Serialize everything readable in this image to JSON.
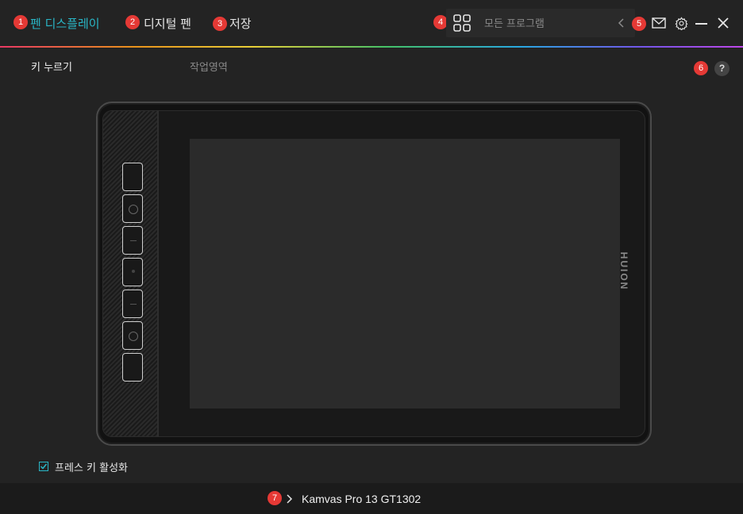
{
  "nav": {
    "tabs": [
      {
        "badge": "1",
        "label": "펜 디스플레이",
        "active": true
      },
      {
        "badge": "2",
        "label": "디지털 펜",
        "active": false
      },
      {
        "badge": "3",
        "label": "저장",
        "active": false
      }
    ]
  },
  "search": {
    "badge": "4",
    "placeholder": "모든 프로그램"
  },
  "toolbar": {
    "badge": "5",
    "icons": [
      "back-arrow-icon",
      "mail-icon",
      "gear-icon",
      "minimize-icon",
      "close-icon"
    ]
  },
  "subtabs": [
    {
      "label": "키 누르기"
    },
    {
      "label": "작업영역"
    }
  ],
  "help": {
    "badge": "6",
    "label": "?"
  },
  "tablet": {
    "brand": "HUION",
    "key_count": 7
  },
  "checkbox": {
    "label": "프레스 키 활성화",
    "checked": true
  },
  "device": {
    "badge": "7",
    "name": "Kamvas Pro 13 GT1302"
  },
  "colors": {
    "accent": "#29b6c6",
    "badge": "#e53935",
    "background": "#232323"
  }
}
